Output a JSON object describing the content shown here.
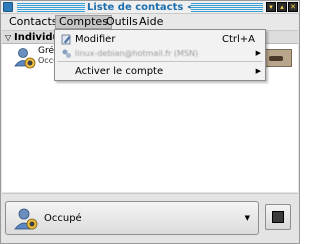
{
  "window": {
    "title": "Liste de contacts <2>",
    "title_color": "#1e6fae"
  },
  "menubar": {
    "items": [
      {
        "label": "Contacts",
        "active": false
      },
      {
        "label": "Comptes",
        "active": true
      },
      {
        "label": "Outils",
        "active": false
      },
      {
        "label": "Aide",
        "active": false
      }
    ]
  },
  "dropdown": {
    "items": [
      {
        "label": "Modifier",
        "shortcut": "Ctrl+A",
        "icon": "edit-icon"
      },
      {
        "label": "linux-debian@hotmail.fr (MSN)",
        "icon": "account-status-icon",
        "submenu": true,
        "blurred": true
      },
      {
        "label": "Activer le compte",
        "submenu": true
      }
    ]
  },
  "contacts": {
    "group_label": "Individu",
    "contact": {
      "name": "Grég",
      "status": "Occup"
    }
  },
  "status_bar": {
    "status_label": "Occupé"
  }
}
